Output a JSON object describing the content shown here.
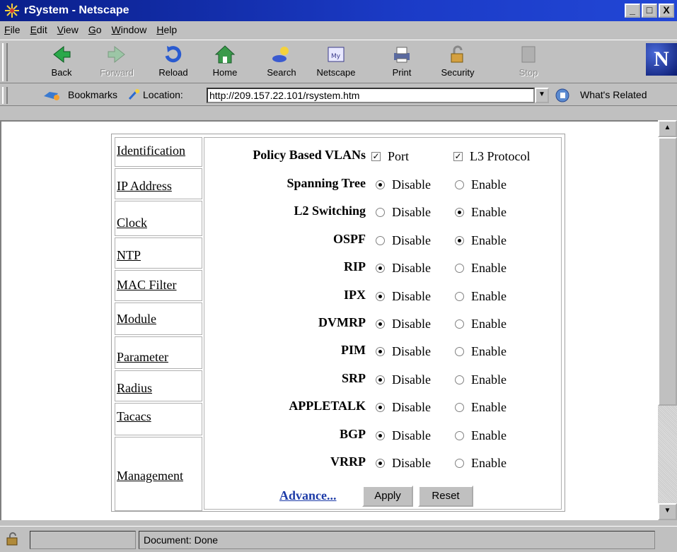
{
  "window": {
    "title": "rSystem - Netscape",
    "min": "_",
    "max": "□",
    "close": "X"
  },
  "menu": [
    {
      "pre": "",
      "u": "F",
      "post": "ile"
    },
    {
      "pre": "",
      "u": "E",
      "post": "dit"
    },
    {
      "pre": "",
      "u": "V",
      "post": "iew"
    },
    {
      "pre": "",
      "u": "G",
      "post": "o"
    },
    {
      "pre": "",
      "u": "W",
      "post": "indow"
    },
    {
      "pre": "",
      "u": "H",
      "post": "elp"
    }
  ],
  "toolbar": {
    "back": "Back",
    "forward": "Forward",
    "reload": "Reload",
    "home": "Home",
    "search": "Search",
    "netscape": "Netscape",
    "print": "Print",
    "security": "Security",
    "stop": "Stop",
    "logo": "N"
  },
  "location": {
    "bookmarks": "Bookmarks",
    "label": "Location:",
    "url": "http://209.157.22.101/rsystem.htm",
    "related": "What's Related"
  },
  "nav": [
    "Identification",
    "IP Address",
    "Clock",
    "NTP",
    "MAC Filter",
    "Module",
    "Parameter",
    "Radius",
    "Tacacs",
    "Management"
  ],
  "form": {
    "vlan_label": "Policy Based VLANs",
    "vlan_port": "Port",
    "vlan_l3": "L3 Protocol",
    "disable": "Disable",
    "enable": "Enable",
    "rows": [
      {
        "label": "Spanning Tree",
        "enabled": false
      },
      {
        "label": "L2 Switching",
        "enabled": true
      },
      {
        "label": "OSPF",
        "enabled": true
      },
      {
        "label": "RIP",
        "enabled": false
      },
      {
        "label": "IPX",
        "enabled": false
      },
      {
        "label": "DVMRP",
        "enabled": false
      },
      {
        "label": "PIM",
        "enabled": false
      },
      {
        "label": "SRP",
        "enabled": false
      },
      {
        "label": "APPLETALK",
        "enabled": false
      },
      {
        "label": "BGP",
        "enabled": false
      },
      {
        "label": "VRRP",
        "enabled": false
      }
    ],
    "advance": "Advance...",
    "apply": "Apply",
    "reset": "Reset"
  },
  "status": {
    "text": "Document: Done"
  }
}
